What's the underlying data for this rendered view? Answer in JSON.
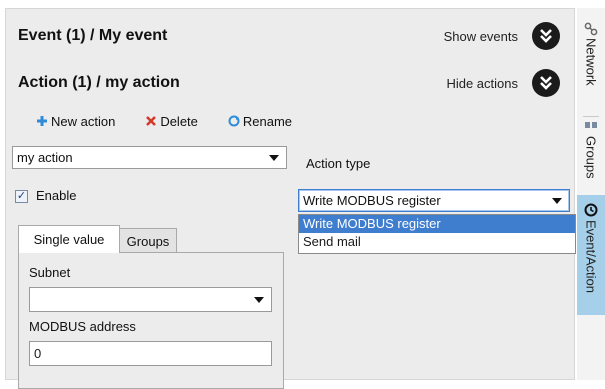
{
  "event_header": {
    "title": "Event (1) / My event",
    "toggle_label": "Show events"
  },
  "action_header": {
    "title": "Action (1) / my action",
    "toggle_label": "Hide actions"
  },
  "toolbar": {
    "new_action": "New action",
    "delete": "Delete",
    "rename": "Rename"
  },
  "action_select": {
    "value": "my action"
  },
  "enable": {
    "label": "Enable",
    "checked": true
  },
  "action_type": {
    "label": "Action type",
    "value": "Write MODBUS register",
    "options": [
      "Write MODBUS register",
      "Send mail"
    ]
  },
  "tabs": [
    "Single value",
    "Groups"
  ],
  "subnet": {
    "label": "Subnet",
    "value": ""
  },
  "modbus": {
    "label": "MODBUS address",
    "value": "0"
  },
  "side_tabs": [
    "Network",
    "Groups",
    "Event/Action"
  ],
  "colors": {
    "selection": "#3f7ecf",
    "active_side_tab": "#a6d0ea",
    "delete_icon": "#d23a2a",
    "add_icon": "#2f8bd8"
  }
}
